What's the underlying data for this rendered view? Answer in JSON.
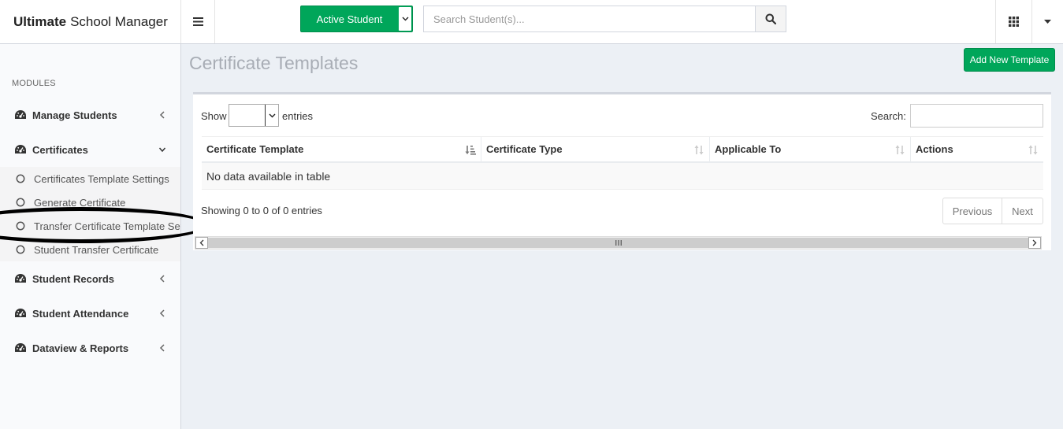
{
  "brand": {
    "bold": "Ultimate",
    "rest": "School Manager"
  },
  "header": {
    "active_student_label": "Active Student",
    "search_placeholder": "Search Student(s)..."
  },
  "sidebar": {
    "section_label": "MODULES",
    "items": [
      {
        "label": "Manage Students",
        "chevron": "left"
      },
      {
        "label": "Certificates",
        "chevron": "down"
      },
      {
        "label": "Student Records",
        "chevron": "left"
      },
      {
        "label": "Student Attendance",
        "chevron": "left"
      },
      {
        "label": "Dataview & Reports",
        "chevron": "left"
      }
    ],
    "certificates_submenu": [
      {
        "label": "Certificates Template Settings"
      },
      {
        "label": "Generate Certificate"
      },
      {
        "label": "Transfer Certificate Template Settings"
      },
      {
        "label": "Student Transfer Certificate"
      }
    ]
  },
  "main": {
    "title": "Certificate Templates",
    "add_button": "Add New Template",
    "table_controls": {
      "show_label": "Show",
      "entries_label": "entries",
      "search_label": "Search:"
    },
    "columns": [
      {
        "label": "Certificate Template"
      },
      {
        "label": "Certificate Type"
      },
      {
        "label": "Applicable To"
      },
      {
        "label": "Actions"
      }
    ],
    "empty_message": "No data available in table",
    "info": "Showing 0 to 0 of 0 entries",
    "pagination": {
      "previous": "Previous",
      "next": "Next"
    }
  },
  "colors": {
    "accent_green": "#00a65a",
    "annotation": "#000000"
  },
  "icons": {
    "menu": "hamburger-icon",
    "search": "magnifier-icon",
    "apps": "grid-icon",
    "module": "dashboard-gauge-icon",
    "subitem": "circle-outline-icon"
  }
}
